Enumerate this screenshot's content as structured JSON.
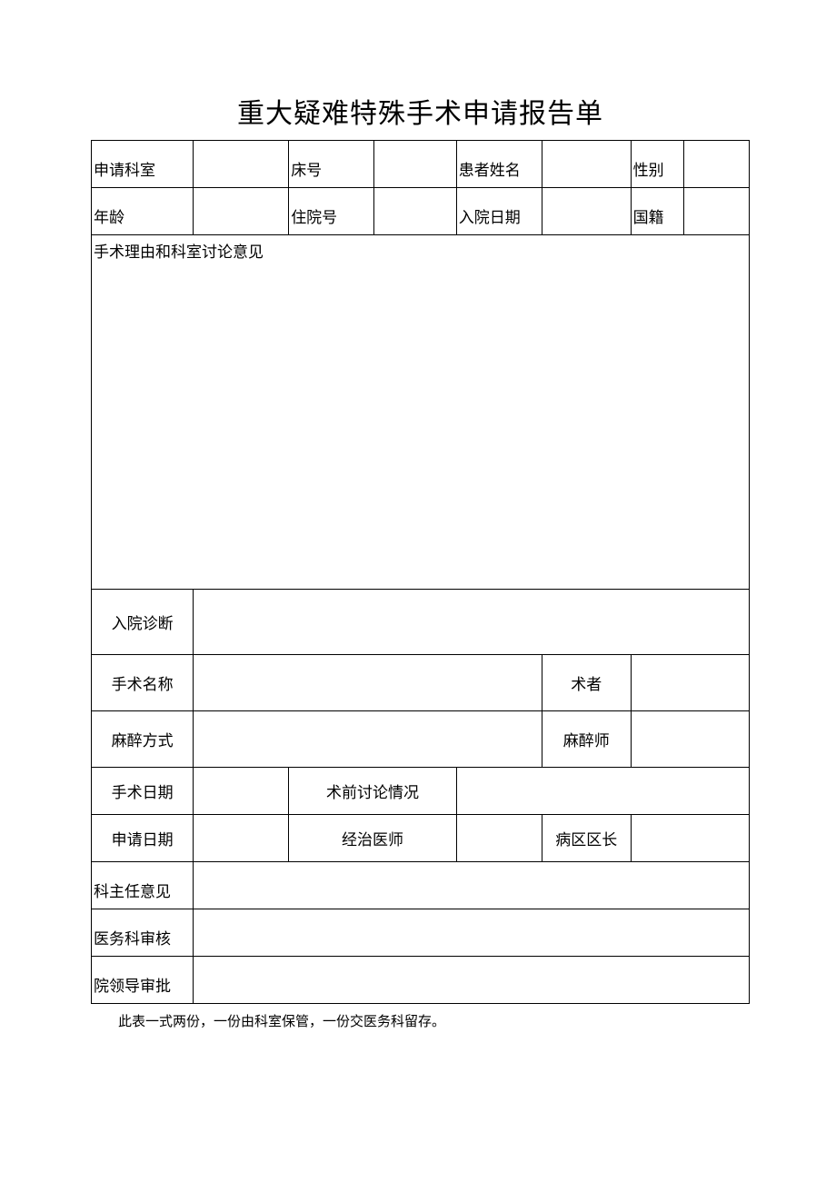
{
  "title": "重大疑难特殊手术申请报告单",
  "row1": {
    "dept_label": "申请科室",
    "dept_value": "",
    "bed_label": "床号",
    "bed_value": "",
    "patient_label": "患者姓名",
    "patient_value": "",
    "gender_label": "性别",
    "gender_value": ""
  },
  "row2": {
    "age_label": "年龄",
    "age_value": "",
    "admission_no_label": "住院号",
    "admission_no_value": "",
    "admission_date_label": "入院日期",
    "admission_date_value": "",
    "nationality_label": "国籍",
    "nationality_value": ""
  },
  "reason_label": "手术理由和科室讨论意见",
  "reason_value": "",
  "diagnosis_label": "入院诊断",
  "diagnosis_value": "",
  "surgery_name_label": "手术名称",
  "surgery_name_value": "",
  "surgeon_label": "术者",
  "surgeon_value": "",
  "anesthesia_label": "麻醉方式",
  "anesthesia_value": "",
  "anesthetist_label": "麻醉师",
  "anesthetist_value": "",
  "surgery_date_label": "手术日期",
  "surgery_date_value": "",
  "preop_label": "术前讨论情况",
  "preop_value": "",
  "apply_date_label": "申请日期",
  "apply_date_value": "",
  "attending_label": "经治医师",
  "attending_value": "",
  "ward_chief_label": "病区区长",
  "ward_chief_value": "",
  "dept_head_label": "科主任意见",
  "dept_head_value": "",
  "medical_review_label": "医务科审核",
  "medical_review_value": "",
  "hospital_approval_label": "院领导审批",
  "hospital_approval_value": "",
  "footer": "此表一式两份，一份由科室保管，一份交医务科留存。"
}
